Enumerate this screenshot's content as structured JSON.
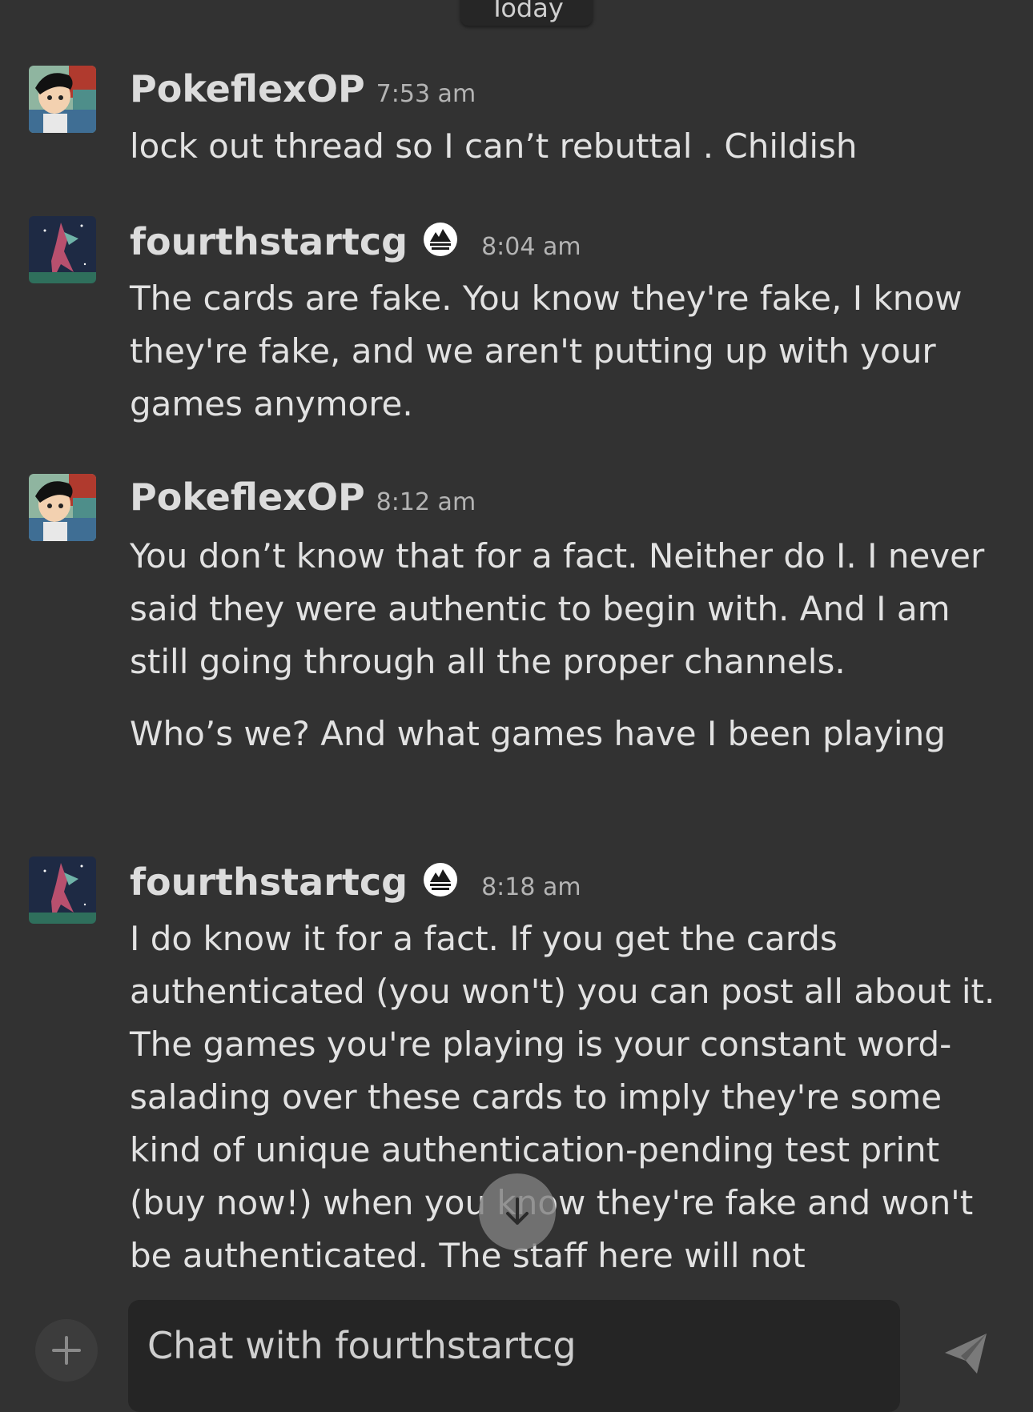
{
  "date_divider": "Today",
  "messages": [
    {
      "username": "PokeflexOP",
      "time": "7:53 am",
      "avatar": "ash-avatar",
      "moderator": false,
      "paragraphs": [
        "lock out thread so I can’t rebuttal . Childish"
      ]
    },
    {
      "username": "fourthstartcg",
      "time": "8:04 am",
      "avatar": "pokemon-avatar",
      "moderator": true,
      "paragraphs": [
        "The cards are fake. You know they're fake, I know they're fake, and we aren't putting up with your games anymore."
      ]
    },
    {
      "username": "PokeflexOP",
      "time": "8:12 am",
      "avatar": "ash-avatar",
      "moderator": false,
      "paragraphs": [
        "You don’t know that for a fact. Neither do I. I never said they were authentic to begin with. And I am still going through all the proper channels.",
        "Who’s we? And what games have I been playing"
      ]
    },
    {
      "username": "fourthstartcg",
      "time": "8:18 am",
      "avatar": "pokemon-avatar",
      "moderator": true,
      "paragraphs": [
        "I do know it for a fact. If you get the cards authenticated (you won't) you can post all about it. The games you're playing is your constant word-salading over these cards to imply they're some kind of unique authentication-pending test print (buy now!) when you know they're fake and won't be authenticated. The staff here will not"
      ]
    }
  ],
  "composer": {
    "placeholder": "Chat with fourthstartcg",
    "add_icon": "plus-icon",
    "send_icon": "send-icon"
  },
  "scroll_button_icon": "arrow-down-icon",
  "colors": {
    "background": "#323232",
    "input_background": "#252525",
    "text": "#e2e2e2",
    "timestamp": "#b4b4b4"
  }
}
